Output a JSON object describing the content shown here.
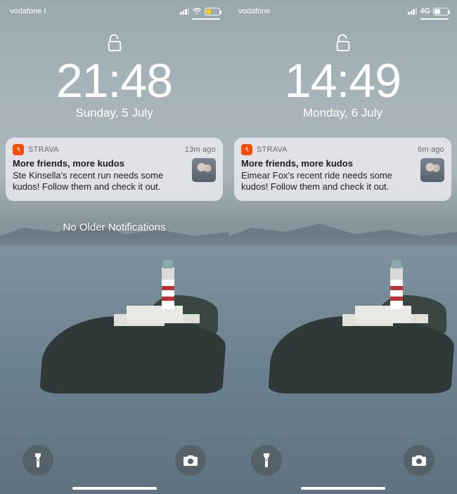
{
  "screens": [
    {
      "statusbar": {
        "carrier": "vodafone I",
        "network_type": "wifi",
        "network_label": "",
        "battery_percent": 40,
        "battery_color": "#ffcc00",
        "low_power": true,
        "show_charging_line": true
      },
      "lock": {
        "time": "21:48",
        "date": "Sunday, 5 July"
      },
      "notification": {
        "app_icon_color": "#fc4c02",
        "app_name": "STRAVA",
        "time_ago": "13m ago",
        "title": "More friends, more kudos",
        "message": "Ste Kinsella's recent run needs some kudos! Follow them and check it out."
      },
      "no_older_text": "No Older Notifications",
      "show_no_older": true
    },
    {
      "statusbar": {
        "carrier": "vodafone",
        "network_type": "cellular",
        "network_label": "4G",
        "battery_percent": 45,
        "battery_color": "#ffffff",
        "low_power": false,
        "show_charging_line": true
      },
      "lock": {
        "time": "14:49",
        "date": "Monday, 6 July"
      },
      "notification": {
        "app_icon_color": "#fc4c02",
        "app_name": "STRAVA",
        "time_ago": "6m ago",
        "title": "More friends, more kudos",
        "message": "Eimear Fox's recent ride needs some kudos! Follow them and check it out."
      },
      "no_older_text": "",
      "show_no_older": false
    }
  ]
}
